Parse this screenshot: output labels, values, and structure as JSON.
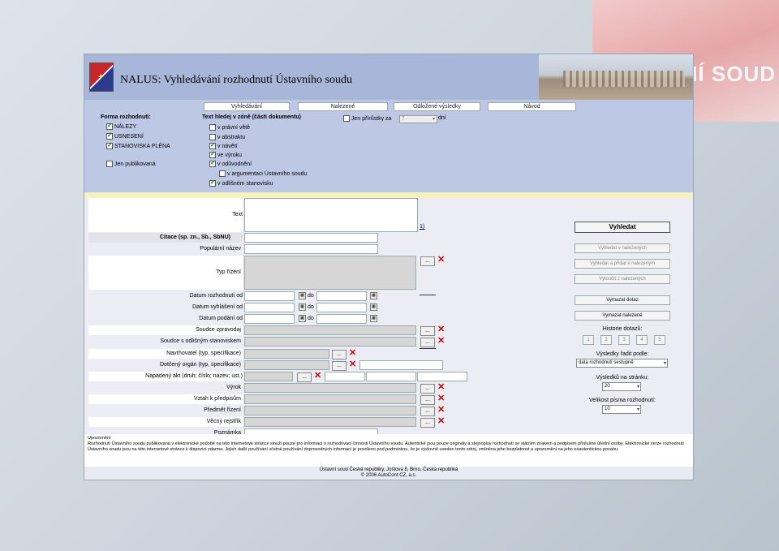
{
  "header": {
    "title": "NALUS: Vyhledávání rozhodnutí Ústavního soudu"
  },
  "decor_text": "NÍ SOUD",
  "tabs": [
    "Vyhledávání",
    "Nalezené",
    "Odložené výsledky",
    "Návod"
  ],
  "filter": {
    "forma_label": "Forma rozhodnutí:",
    "forma_items": [
      {
        "label": "NÁLEZY",
        "checked": true
      },
      {
        "label": "USNESENÍ",
        "checked": true
      },
      {
        "label": "STANOVISKA PLÉNA",
        "checked": true
      }
    ],
    "publ_label": "Jen publikovaná",
    "text_zone_label": "Text hledej v zóně (části dokumentu)",
    "zones": [
      {
        "label": "v právní větě",
        "checked": false
      },
      {
        "label": "v abstraktu",
        "checked": false
      },
      {
        "label": "v návětí",
        "checked": true
      },
      {
        "label": "ve výroku",
        "checked": true
      },
      {
        "label": "v odůvodnění",
        "checked": true
      },
      {
        "label": "v argumentaci Ústavního soudu",
        "checked": false
      },
      {
        "label": "v odlišném stanovisku",
        "checked": true
      }
    ],
    "prirustky_prefix": "Jen přírůstky za",
    "prirustky_value": "7",
    "prirustky_suffix": "dní"
  },
  "form": {
    "text": "Text",
    "link": "1)",
    "citace": "Citace (sp. zn., Sb., SbNU)",
    "popularni": "Populární název",
    "typ_rizeni": "Typ řízení",
    "datum_rozhodnuti": "Datum rozhodnutí od",
    "datum_vyhlaseni": "Datum vyhlášení od",
    "datum_podani": "Datum podání od",
    "do": "do",
    "soudce_zpravodaj": "Soudce zpravodaj",
    "soudce_odlisne": "Soudce s odlišným stanoviskem",
    "navrhovatel": "Navrhovatel (typ, specifikace)",
    "dotceny": "Dotčený orgán (typ, specifikace)",
    "napadeny": "Napadený akt (druh; číslo; název; ust.)",
    "vyrok": "Výrok",
    "vztah": "Vztah k předpisům",
    "predmet": "Předmět řízení",
    "vecny": "Věcný rejstřík",
    "poznamka": "Poznámka",
    "dots": "..."
  },
  "right": {
    "vyhledat": "Vyhledat",
    "vyhledat_v_nalezenych": "Vyhledat v nalezených",
    "vyhledat_pridat": "Vyhledat a přidat k nalezeným",
    "vyloucit": "Vyloučit z nalezených",
    "vymazat_dotaz": "Vymazat dotaz",
    "vymazat_nalezene": "Vymazat nalezené",
    "historie": "Historie dotazů:",
    "hist": [
      "1",
      "2",
      "3",
      "4",
      "5"
    ],
    "radit_label": "Výsledky řadit podle:",
    "radit_value": "data rozhodnutí sestupně",
    "na_stranku_label": "Výsledků na stránku:",
    "na_stranku_value": "20",
    "pismo_label": "Velikost písma rozhodnutí:",
    "pismo_value": "10"
  },
  "footer": {
    "upozorneni": "Upozornění",
    "text1": "Rozhodnutí Ústavního soudu publikovaná v elektronické podobě na této internetové stránce slouží pouze pro informaci o rozhodovací činnosti Ústavního soudu. Autentické jsou pouze originály a stejnopisy rozhodnutí se státním znakem a podpisem příslušné úřední osoby. Elektronické verze rozhodnutí Ústavního soudu jsou na této internetové stránce k dispozici zdarma. Jejich další používání včetně používání doprovodných informací je povoleno pod podmínkou, že je výslovně uveden tento zdroj, zmíněna jeho bezplatnost a upozornění na jeho neautentickou povahu.",
    "address": "Ústavní soud České republiky, Joštova 8, Brno, Česká republika",
    "copyright": "© 2006 AutoCont CZ, a.s."
  }
}
